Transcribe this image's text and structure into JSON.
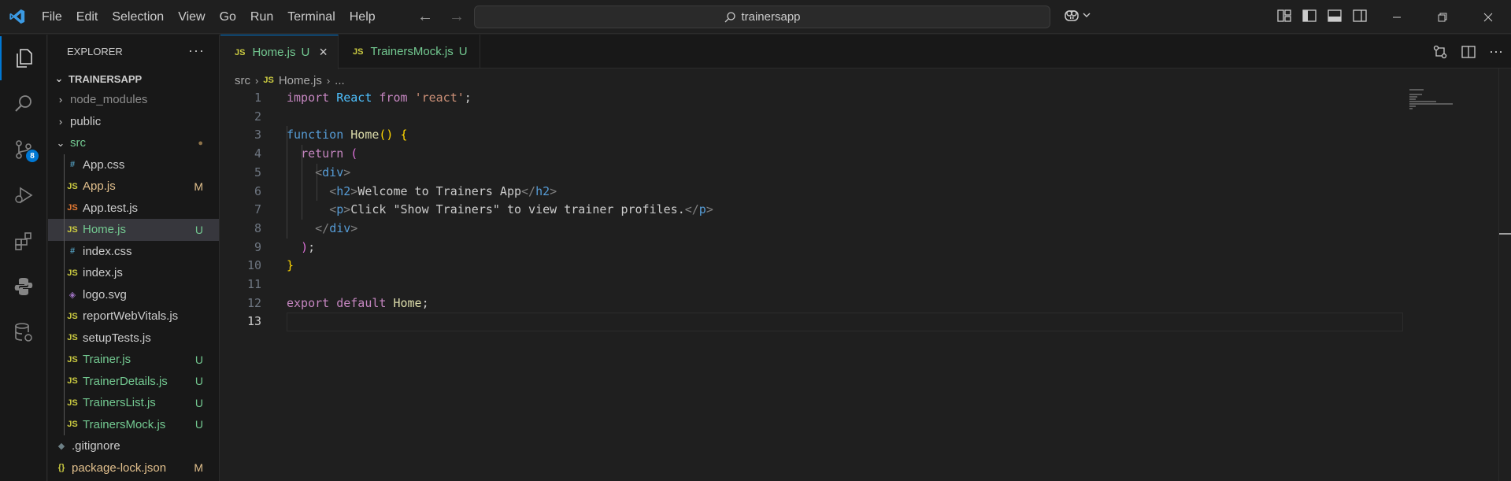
{
  "colors": {
    "accent": "#0078d4",
    "untracked": "#73c991",
    "modified": "#e2c08d",
    "js_icon": "#cbcb41",
    "css_icon": "#519aba"
  },
  "menu": [
    "File",
    "Edit",
    "Selection",
    "View",
    "Go",
    "Run",
    "Terminal",
    "Help"
  ],
  "search": {
    "text": "trainersapp"
  },
  "activity": {
    "scm_badge": "8"
  },
  "sidebar": {
    "title": "EXPLORER",
    "more": "···",
    "root": "TRAINERSAPP",
    "items": [
      {
        "label": "node_modules",
        "type": "folder",
        "status": "",
        "color": "#8c8c8c"
      },
      {
        "label": "public",
        "type": "folder",
        "status": "",
        "color": "#cccccc"
      },
      {
        "label": "src",
        "type": "folder-open",
        "status": "●",
        "color": "#73c991"
      },
      {
        "label": "App.css",
        "type": "css",
        "status": "",
        "color": "#cccccc"
      },
      {
        "label": "App.js",
        "type": "js",
        "status": "M",
        "color": "#e2c08d"
      },
      {
        "label": "App.test.js",
        "type": "test",
        "status": "",
        "color": "#cccccc"
      },
      {
        "label": "Home.js",
        "type": "js",
        "status": "U",
        "color": "#73c991"
      },
      {
        "label": "index.css",
        "type": "css",
        "status": "",
        "color": "#cccccc"
      },
      {
        "label": "index.js",
        "type": "js",
        "status": "",
        "color": "#cccccc"
      },
      {
        "label": "logo.svg",
        "type": "svg",
        "status": "",
        "color": "#cccccc"
      },
      {
        "label": "reportWebVitals.js",
        "type": "js",
        "status": "",
        "color": "#cccccc"
      },
      {
        "label": "setupTests.js",
        "type": "js",
        "status": "",
        "color": "#cccccc"
      },
      {
        "label": "Trainer.js",
        "type": "js",
        "status": "U",
        "color": "#73c991"
      },
      {
        "label": "TrainerDetails.js",
        "type": "js",
        "status": "U",
        "color": "#73c991"
      },
      {
        "label": "TrainersList.js",
        "type": "js",
        "status": "U",
        "color": "#73c991"
      },
      {
        "label": "TrainersMock.js",
        "type": "js",
        "status": "U",
        "color": "#73c991"
      },
      {
        "label": ".gitignore",
        "type": "git",
        "status": "",
        "color": "#cccccc"
      },
      {
        "label": "package-lock.json",
        "type": "json",
        "status": "M",
        "color": "#e2c08d"
      }
    ]
  },
  "tabs": [
    {
      "icon": "JS",
      "label": "Home.js",
      "status": "U",
      "close": "×"
    },
    {
      "icon": "JS",
      "label": "TrainersMock.js",
      "status": "U"
    }
  ],
  "breadcrumb": {
    "folder": "src",
    "file_icon": "JS",
    "file": "Home.js",
    "rest": "..."
  },
  "code": {
    "line_numbers": [
      "1",
      "2",
      "3",
      "4",
      "5",
      "6",
      "7",
      "8",
      "9",
      "10",
      "11",
      "12",
      "13"
    ],
    "l1": {
      "kw": "import",
      "name": "React",
      "from": "from",
      "str": "'react'",
      "end": ";"
    },
    "l3": {
      "kw": "function",
      "fn": "Home",
      "paren": "()",
      "brace": "{"
    },
    "l4": {
      "kw": "return",
      "paren": "("
    },
    "l5": {
      "open": "<",
      "tag": "div",
      "close": ">"
    },
    "l6": {
      "open": "<",
      "tag": "h2",
      "close": ">",
      "text": "Welcome to Trainers App",
      "end_open": "</",
      "end_tag": "h2",
      "end_close": ">"
    },
    "l7": {
      "open": "<",
      "tag": "p",
      "close": ">",
      "text": "Click \"Show Trainers\" to view trainer profiles.",
      "end_open": "</",
      "end_tag": "p",
      "end_close": ">"
    },
    "l8": {
      "open": "</",
      "tag": "div",
      "close": ">"
    },
    "l9": {
      "paren": ")",
      "end": ";"
    },
    "l10": {
      "brace": "}"
    },
    "l12": {
      "kw1": "export",
      "kw2": "default",
      "name": "Home",
      "end": ";"
    }
  }
}
